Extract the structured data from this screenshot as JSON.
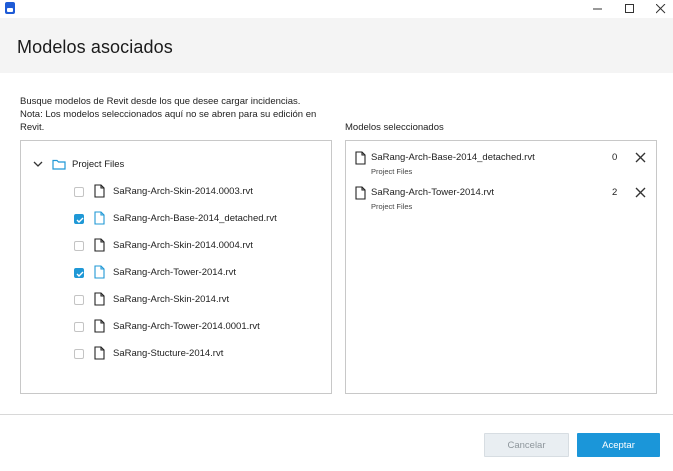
{
  "window": {
    "minimize_icon": "minimize-icon",
    "maximize_icon": "maximize-icon",
    "close_icon": "close-icon"
  },
  "header": {
    "title": "Modelos asociados"
  },
  "instructions": {
    "line1": "Busque modelos de Revit desde los que desee cargar incidencias.",
    "line2": "Nota: Los modelos seleccionados aquí no se abren para su edición en",
    "line3": "Revit."
  },
  "tree": {
    "folder_label": "Project Files",
    "files": [
      {
        "name": "SaRang-Arch-Skin-2014.0003.rvt",
        "checked": false
      },
      {
        "name": "SaRang-Arch-Base-2014_detached.rvt",
        "checked": true
      },
      {
        "name": "SaRang-Arch-Skin-2014.0004.rvt",
        "checked": false
      },
      {
        "name": "SaRang-Arch-Tower-2014.rvt",
        "checked": true
      },
      {
        "name": "SaRang-Arch-Skin-2014.rvt",
        "checked": false
      },
      {
        "name": "SaRang-Arch-Tower-2014.0001.rvt",
        "checked": false
      },
      {
        "name": "SaRang-Stucture-2014.rvt",
        "checked": false
      }
    ]
  },
  "selected": {
    "title": "Modelos seleccionados",
    "items": [
      {
        "name": "SaRang-Arch-Base-2014_detached.rvt",
        "location": "Project Files",
        "count": "0"
      },
      {
        "name": "SaRang-Arch-Tower-2014.rvt",
        "location": "Project Files",
        "count": "2"
      }
    ]
  },
  "footer": {
    "cancel_label": "Cancelar",
    "accept_label": "Aceptar"
  },
  "colors": {
    "accent": "#1b96d9",
    "header_bg": "#f4f4f4",
    "folder": "#1f98d6"
  }
}
